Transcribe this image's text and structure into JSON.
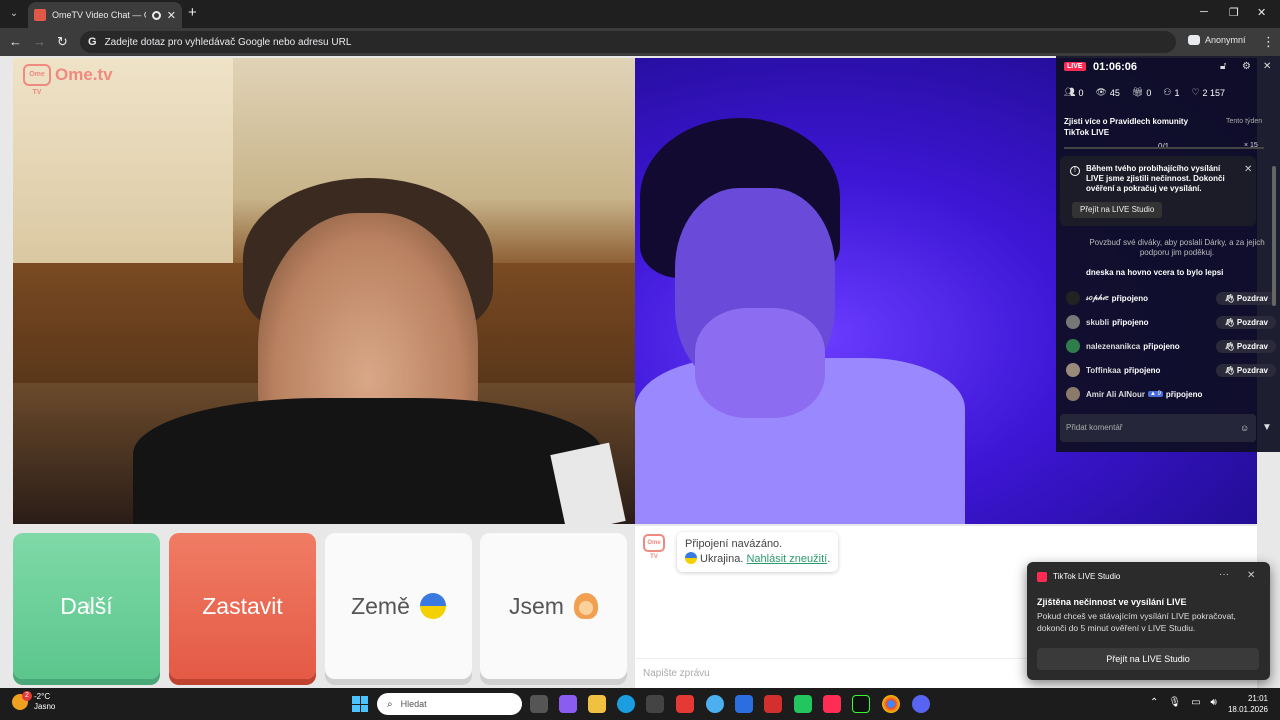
{
  "browser": {
    "tab_title": "OmeTV Video Chat — Ome",
    "omnibox_placeholder": "Zadejte dotaz pro vyhledávač Google nebo adresu URL",
    "incognito_label": "Anonymní"
  },
  "page": {
    "logo_text": "Ome.tv",
    "logo_badge": "Ome TV"
  },
  "tiktok": {
    "live_label": "LIVE",
    "timer": "01:06:06",
    "stats": {
      "people": "0",
      "views": "45",
      "gifts": "0",
      "new_followers": "1",
      "likes": "2 157"
    },
    "rules_text": "Zjisti více o Pravidlech komunity TikTok LIVE",
    "week_label": "Tento týden",
    "progress_label": "0/1",
    "progress_fraction": 0,
    "progress_multiplier": "× 15",
    "warning_text": "Během tvého probíhajícího vysílání LIVE jsme zjistili nečinnost. Dokonči ověření a pokračuj ve vysílání.",
    "warning_button": "Přejít na LIVE Studio",
    "cheer_text": "Povzbuď své diváky, aby poslali Dárky, a za jejich podporu jim poděkuj.",
    "comment": "dneska na hovno vcera to bylo lepsi",
    "joins": [
      {
        "name": "𝓈𝑜𝓅𝒽𝒾𝑒",
        "status": "připojeno",
        "greet": "Pozdrav",
        "avatar_color": "#222222"
      },
      {
        "name": "skubli",
        "status": "připojeno",
        "greet": "Pozdrav",
        "avatar_color": "#777777"
      },
      {
        "name": "nalezenanikca",
        "status": "připojeno",
        "greet": "Pozdrav",
        "avatar_color": "#2f7d4a"
      },
      {
        "name": "Toffinkaa",
        "status": "připojeno",
        "greet": "Pozdrav",
        "avatar_color": "#9a8a7a"
      },
      {
        "name": "Amir Ali AlNour",
        "level": "9",
        "status": "připojeno",
        "avatar_color": "#8a7a6a"
      }
    ],
    "add_comment_placeholder": "Přidat komentář"
  },
  "controls": {
    "next": "Další",
    "stop": "Zastavit",
    "country": "Země",
    "gender": "Jsem"
  },
  "chat": {
    "logo_badge": "Ome TV",
    "status": "Připojení navázáno.",
    "country": "Ukrajina.",
    "report_link": "Nahlásit zneužití",
    "input_placeholder": "Napište zprávu"
  },
  "toast": {
    "app": "TikTok LIVE Studio",
    "title": "Zjištěna nečinnost ve vysílání LIVE",
    "body": "Pokud chceš ve stávajícím vysílání LIVE pokračovat, dokonči do 5 minut ověření v LIVE Studiu.",
    "button": "Přejít na LIVE Studio"
  },
  "taskbar": {
    "weather_badge": "2",
    "temp": "-2°C",
    "condition": "Jasno",
    "search_placeholder": "Hledat",
    "time": "21:01",
    "date": "18.01.2026"
  }
}
